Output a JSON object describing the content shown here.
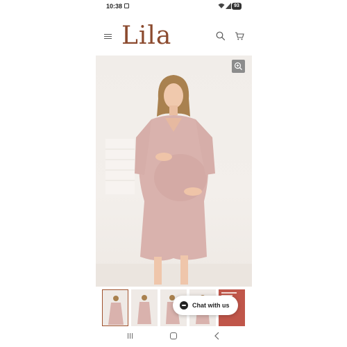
{
  "status_bar": {
    "time": "10:38",
    "battery": "93",
    "icons": [
      "screenshot-icon",
      "wifi-icon",
      "signal-icon"
    ]
  },
  "header": {
    "logo": "Lila",
    "logo_color": "#8b4a2e",
    "icons": [
      "menu-icon",
      "search-icon",
      "cart-icon"
    ]
  },
  "product_gallery": {
    "zoom_icon": "zoom-in-icon",
    "dress_color": "#d9b2ad",
    "thumbnail_count": 5,
    "active_thumbnail": 1
  },
  "chat": {
    "label": "Chat with us"
  },
  "nav_bar": {
    "icons": [
      "recents-icon",
      "home-icon",
      "back-icon"
    ]
  }
}
